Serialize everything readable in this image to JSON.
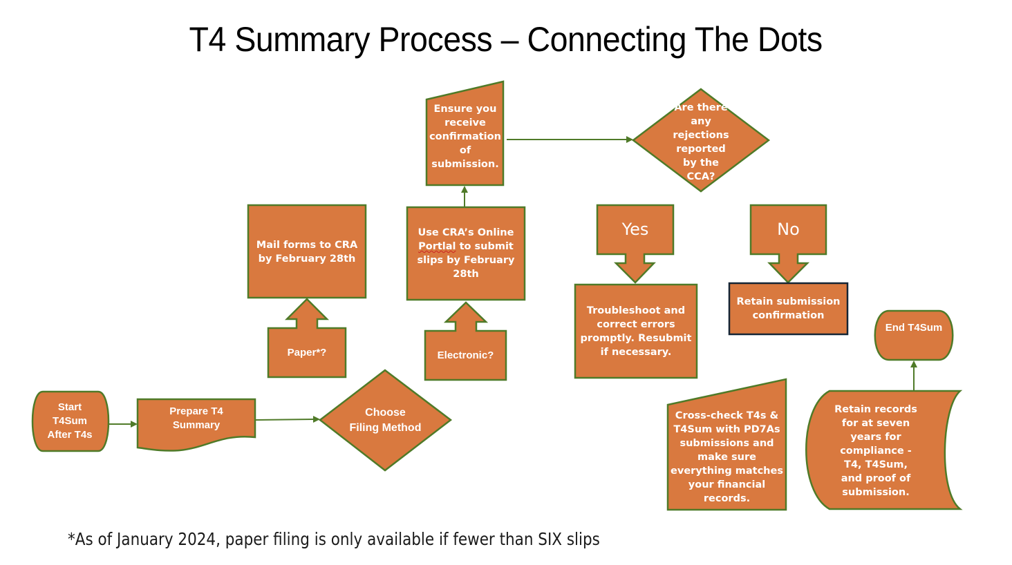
{
  "title": "T4 Summary Process – Connecting The Dots",
  "footnote": "*As of January 2024, paper filing is only available if fewer than SIX slips",
  "colors": {
    "shape_fill": "#D9793F",
    "shape_stroke": "#4F7A28",
    "retain_confirmation_stroke": "#152535",
    "connector": "#4F7A28",
    "text": "#FFFFFF"
  },
  "nodes": {
    "start": {
      "type": "terminator",
      "text": "Start T4Sum After T4s"
    },
    "prepare": {
      "type": "document",
      "text": "Prepare T4 Summary"
    },
    "choose": {
      "type": "decision",
      "text": "Choose Filing Method"
    },
    "paper": {
      "type": "up-arrow-callout",
      "text": "Paper*?"
    },
    "electronic": {
      "type": "up-arrow-callout",
      "text": "Electronic?"
    },
    "mail": {
      "type": "process",
      "text": "Mail forms to CRA by February 28th"
    },
    "online": {
      "type": "process",
      "text_before": "Use CRA’s Online ",
      "text_flagged": "Portlal",
      "text_after": " to submit slips by February 28th"
    },
    "ensure": {
      "type": "manual-input",
      "text": "Ensure you receive confirmation of submission."
    },
    "rejections": {
      "type": "decision",
      "text": "Are there any rejections reported by the CCA?"
    },
    "yes": {
      "type": "down-arrow-callout",
      "text": "Yes"
    },
    "no": {
      "type": "down-arrow-callout",
      "text": "No"
    },
    "troubleshoot": {
      "type": "process",
      "text": "Troubleshoot and correct errors promptly. Resubmit if necessary."
    },
    "retain_confirmation": {
      "type": "process",
      "text": "Retain submission confirmation"
    },
    "crosscheck": {
      "type": "manual-input",
      "text": "Cross-check T4s & T4Sum with PD7As submissions and make sure everything matches your financial records."
    },
    "retain_records": {
      "type": "stored-data",
      "text": "Retain records for at seven years for compliance -  T4, T4Sum, and proof of submission."
    },
    "end": {
      "type": "terminator",
      "text": "End T4Sum"
    }
  },
  "edges": [
    {
      "from": "start",
      "to": "prepare"
    },
    {
      "from": "prepare",
      "to": "choose"
    },
    {
      "from": "online",
      "to": "ensure"
    },
    {
      "from": "ensure",
      "to": "rejections"
    },
    {
      "from": "retain_records",
      "to": "end"
    }
  ]
}
